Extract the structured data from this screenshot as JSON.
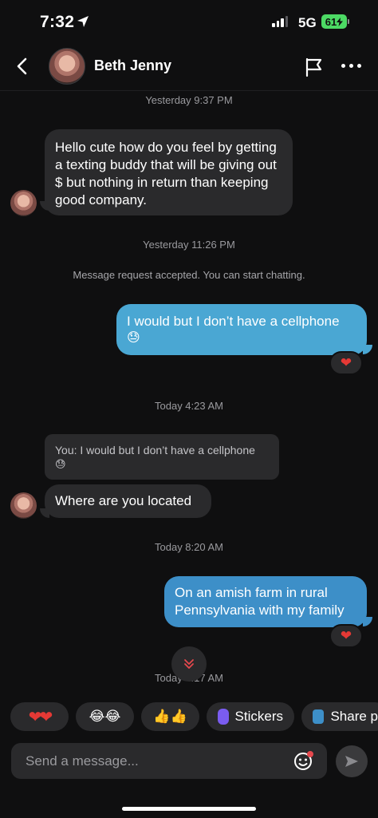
{
  "status_bar": {
    "time": "7:32",
    "network": "5G",
    "battery": "61"
  },
  "header": {
    "name": "Beth Jenny"
  },
  "messages": {
    "ts1": "Yesterday 9:37 PM",
    "m1": "Hello cute how do you feel by getting a texting buddy that will be giving out $ but nothing in return than keeping good company.",
    "ts2": "Yesterday 11:26 PM",
    "system": "Message request accepted. You can start chatting.",
    "m2": "I would but I don’t have a cellphone",
    "m2_emoji": "😓",
    "m2_reaction": "❤",
    "ts3": "Today 4:23 AM",
    "reply_quote": "You: I would but I don’t have a cellphone",
    "reply_emoji": "😓",
    "m3": "Where are you located",
    "ts4": "Today 8:20 AM",
    "m4": "On an amish farm in rural Pennsylvania with my family",
    "m4_reaction": "❤",
    "ts5": "Today 4:17 AM"
  },
  "quick_replies": {
    "hearts": "❤❤",
    "laugh": "😂😂",
    "thumbs": "👍👍",
    "stickers": "Stickers",
    "share": "Share p"
  },
  "composer": {
    "placeholder": "Send a message..."
  }
}
